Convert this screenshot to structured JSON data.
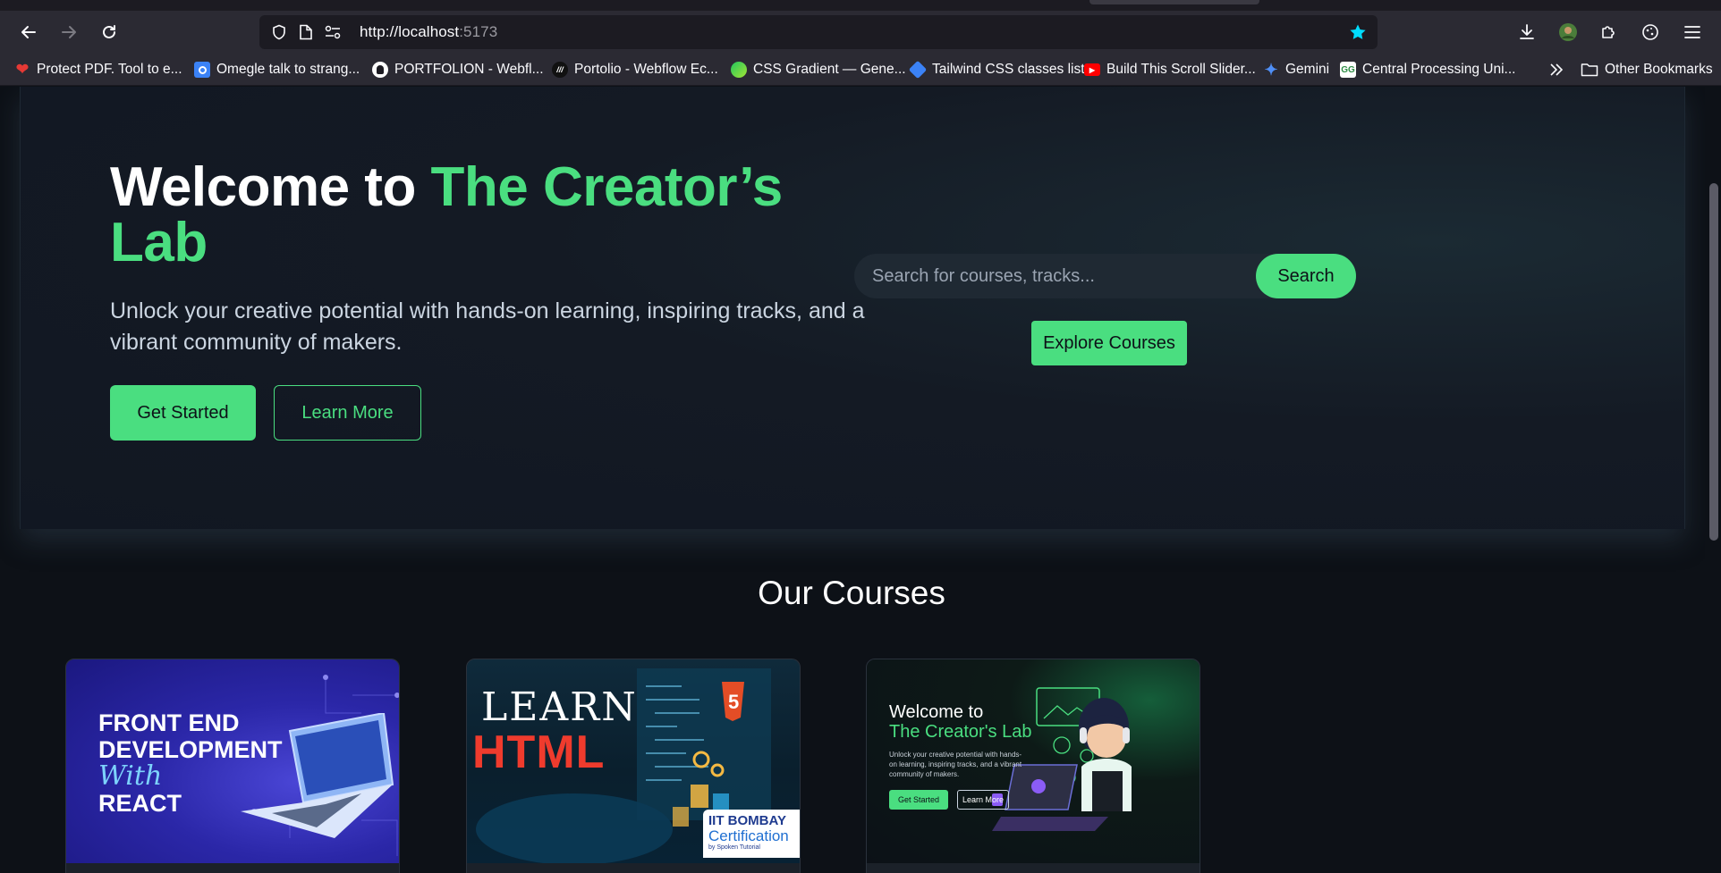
{
  "browser": {
    "url_host": "http://localhost",
    "url_port": ":5173",
    "bookmarks": [
      {
        "label": "Protect PDF. Tool to e...",
        "icon": "pdf-heart-icon",
        "color": "#e53935"
      },
      {
        "label": "Omegle talk to strang...",
        "icon": "omegle-icon",
        "color": "#3b82f6"
      },
      {
        "label": "PORTFOLION - Webfl...",
        "icon": "github-icon",
        "color": "#ffffff"
      },
      {
        "label": "Portolio - Webflow Ec...",
        "icon": "webflow-icon",
        "color": "#111111"
      },
      {
        "label": "CSS Gradient — Gene...",
        "icon": "gradient-icon",
        "color": "#22c55e"
      },
      {
        "label": "Tailwind CSS classes list",
        "icon": "tailwind-icon",
        "color": "#3b82f6"
      },
      {
        "label": "Build This Scroll Slider...",
        "icon": "youtube-icon",
        "color": "#ff0000"
      },
      {
        "label": "Gemini",
        "icon": "gemini-icon",
        "color": "#4f8ff7"
      },
      {
        "label": "Central Processing Uni...",
        "icon": "geeksforgeeks-icon",
        "color": "#2f8d46"
      }
    ],
    "other_bookmarks": "Other Bookmarks"
  },
  "hero": {
    "title_prefix": "Welcome to ",
    "title_accent": "The Creator’s Lab",
    "subtitle": "Unlock your creative potential with hands-on learning, inspiring tracks, and a vibrant community of makers.",
    "primary_cta": "Get Started",
    "secondary_cta": "Learn More",
    "search_placeholder": "Search for courses, tracks...",
    "search_button": "Search",
    "explore_button": "Explore Courses"
  },
  "courses": {
    "heading": "Our Courses",
    "cards": [
      {
        "line1": "FRONT END",
        "line2": "DEVELOPMENT",
        "line3": "With",
        "line4": "REACT"
      },
      {
        "line1": "LEARN",
        "line2": "HTML",
        "badge1": "IIT BOMBAY",
        "badge2": "Certification",
        "badge3": "by Spoken Tutorial"
      },
      {
        "line1": "Welcome to",
        "line2": "The Creator's Lab",
        "sub": "Unlock your creative potential with hands-on learning, inspiring tracks, and a vibrant community of makers.",
        "btn1": "Get Started",
        "btn2": "Learn More"
      }
    ]
  },
  "colors": {
    "accent": "#4ade80",
    "page_bg": "#0d1117",
    "hero_bg": "#141a24"
  }
}
